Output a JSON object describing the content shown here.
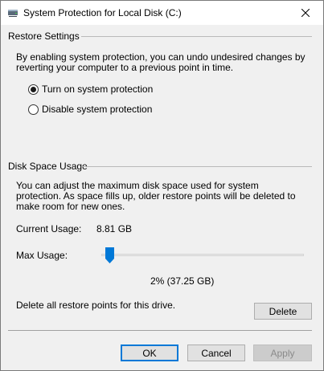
{
  "window": {
    "title": "System Protection for Local Disk (C:)",
    "icon": "disk-icon"
  },
  "restore_settings": {
    "header": "Restore Settings",
    "description": "By enabling system protection, you can undo undesired changes by reverting your computer to a previous point in time.",
    "options": [
      {
        "label": "Turn on system protection",
        "checked": true
      },
      {
        "label": "Disable system protection",
        "checked": false
      }
    ]
  },
  "disk_space": {
    "header": "Disk Space Usage",
    "description": "You can adjust the maximum disk space used for system protection. As space fills up, older restore points will be deleted to make room for new ones.",
    "current_usage_label": "Current Usage:",
    "current_usage_value": "8.81 GB",
    "max_usage_label": "Max Usage:",
    "max_usage_percent": 2,
    "max_usage_readout": "2% (37.25 GB)",
    "delete_text": "Delete all restore points for this drive.",
    "delete_button": "Delete"
  },
  "footer": {
    "ok": "OK",
    "cancel": "Cancel",
    "apply": "Apply",
    "apply_enabled": false
  },
  "colors": {
    "accent": "#0078d7",
    "dialog_bg": "#f0f0f0"
  }
}
